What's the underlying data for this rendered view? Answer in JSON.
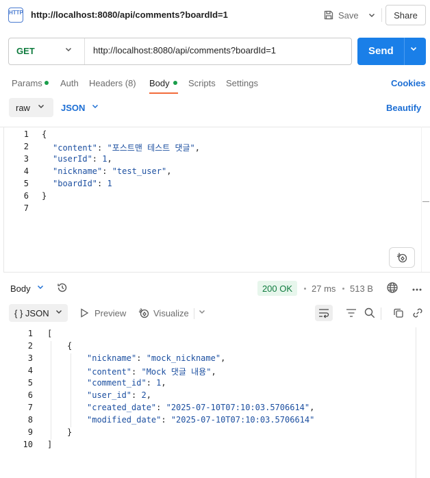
{
  "titlebar": {
    "icon_text": "HTTP",
    "url": "http://localhost:8080/api/comments?boardId=1",
    "save_label": "Save",
    "share_label": "Share"
  },
  "request": {
    "method": "GET",
    "url": "http://localhost:8080/api/comments?boardId=1",
    "send_label": "Send"
  },
  "tabs": {
    "params": "Params",
    "auth": "Auth",
    "headers": "Headers (8)",
    "body": "Body",
    "scripts": "Scripts",
    "settings": "Settings",
    "cookies": "Cookies"
  },
  "body_options": {
    "mode": "raw",
    "format": "JSON",
    "beautify": "Beautify"
  },
  "request_body": {
    "line_numbers": [
      "1",
      "2",
      "3",
      "4",
      "5",
      "6",
      "7"
    ],
    "l1": "{",
    "l2_key": "\"content\"",
    "l2_val": "\"포스트맨 테스트 댓글\"",
    "l3_key": "\"userId\"",
    "l3_val": "1",
    "l4_key": "\"nickname\"",
    "l4_val": "\"test_user\"",
    "l5_key": "\"boardId\"",
    "l5_val": "1",
    "l6": "}"
  },
  "response": {
    "view_label": "Body",
    "status": "200 OK",
    "time": "27 ms",
    "size": "513 B",
    "format_label": "JSON",
    "format_prefix": "{ }",
    "preview_label": "Preview",
    "visualize_label": "Visualize",
    "line_numbers": [
      "1",
      "2",
      "3",
      "4",
      "5",
      "6",
      "7",
      "8",
      "9",
      "10"
    ],
    "l1": "[",
    "l2": "{",
    "nickname_key": "\"nickname\"",
    "nickname_val": "\"mock_nickname\"",
    "content_key": "\"content\"",
    "content_val": "\"Mock 댓글 내용\"",
    "comment_id_key": "\"comment_id\"",
    "comment_id_val": "1",
    "user_id_key": "\"user_id\"",
    "user_id_val": "2",
    "created_key": "\"created_date\"",
    "created_val": "\"2025-07-10T07:10:03.5706614\"",
    "modified_key": "\"modified_date\"",
    "modified_val": "\"2025-07-10T07:10:03.5706614\"",
    "l9": "}",
    "l10": "]"
  },
  "colors": {
    "accent": "#1a7fe8",
    "method_get": "#0f7b3e",
    "active_tab_underline": "#f26b3a",
    "status_ok_bg": "#e7f6ec",
    "code_token": "#1c4fa0"
  },
  "icons": [
    "http-icon",
    "save-icon",
    "chevron-down-icon",
    "history-icon",
    "globe-icon",
    "more-icon",
    "preview-icon",
    "visualize-icon",
    "wrap-lines-icon",
    "filter-icon",
    "search-icon",
    "copy-icon",
    "link-icon",
    "eraser-icon"
  ]
}
